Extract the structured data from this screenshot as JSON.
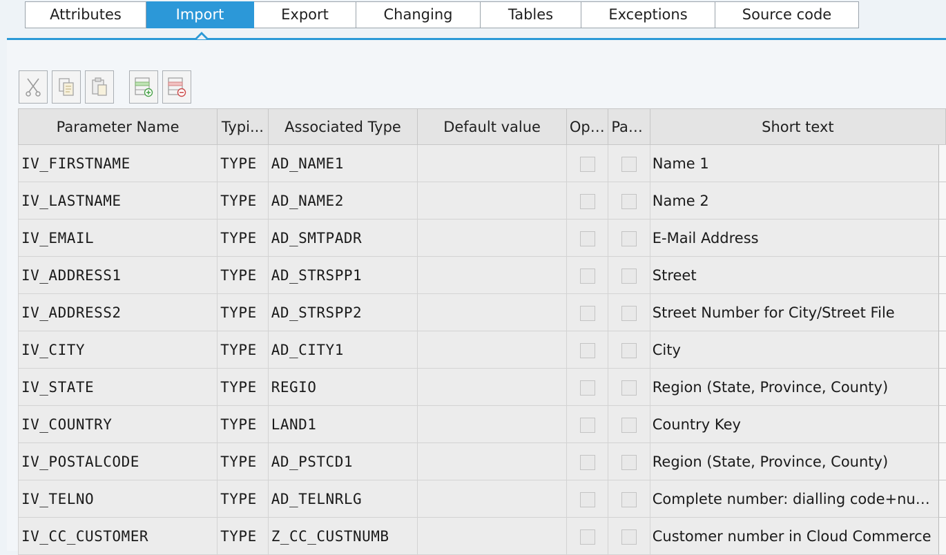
{
  "tabs": [
    {
      "label": "Attributes",
      "active": false
    },
    {
      "label": "Import",
      "active": true
    },
    {
      "label": "Export",
      "active": false
    },
    {
      "label": "Changing",
      "active": false
    },
    {
      "label": "Tables",
      "active": false
    },
    {
      "label": "Exceptions",
      "active": false
    },
    {
      "label": "Source code",
      "active": false
    }
  ],
  "toolbar": {
    "buttons": [
      {
        "icon": "cut-icon"
      },
      {
        "icon": "copy-icon"
      },
      {
        "icon": "paste-icon"
      },
      {
        "icon": "insert-row-icon"
      },
      {
        "icon": "delete-row-icon"
      }
    ]
  },
  "table": {
    "columns": [
      "Parameter Name",
      "Typi...",
      "Associated Type",
      "Default value",
      "Opt...",
      "Pas...",
      "Short text"
    ],
    "rows": [
      {
        "name": "IV_FIRSTNAME",
        "typing": "TYPE",
        "assoc": "AD_NAME1",
        "default": "",
        "optional": false,
        "pass_value": false,
        "short_text": "Name 1"
      },
      {
        "name": "IV_LASTNAME",
        "typing": "TYPE",
        "assoc": "AD_NAME2",
        "default": "",
        "optional": false,
        "pass_value": false,
        "short_text": "Name 2"
      },
      {
        "name": "IV_EMAIL",
        "typing": "TYPE",
        "assoc": "AD_SMTPADR",
        "default": "",
        "optional": false,
        "pass_value": false,
        "short_text": "E-Mail Address"
      },
      {
        "name": "IV_ADDRESS1",
        "typing": "TYPE",
        "assoc": "AD_STRSPP1",
        "default": "",
        "optional": false,
        "pass_value": false,
        "short_text": "Street"
      },
      {
        "name": "IV_ADDRESS2",
        "typing": "TYPE",
        "assoc": "AD_STRSPP2",
        "default": "",
        "optional": false,
        "pass_value": false,
        "short_text": "Street Number for City/Street File"
      },
      {
        "name": "IV_CITY",
        "typing": "TYPE",
        "assoc": "AD_CITY1",
        "default": "",
        "optional": false,
        "pass_value": false,
        "short_text": "City"
      },
      {
        "name": "IV_STATE",
        "typing": "TYPE",
        "assoc": "REGIO",
        "default": "",
        "optional": false,
        "pass_value": false,
        "short_text": "Region (State, Province, County)"
      },
      {
        "name": "IV_COUNTRY",
        "typing": "TYPE",
        "assoc": "LAND1",
        "default": "",
        "optional": false,
        "pass_value": false,
        "short_text": "Country Key"
      },
      {
        "name": "IV_POSTALCODE",
        "typing": "TYPE",
        "assoc": "AD_PSTCD1",
        "default": "",
        "optional": false,
        "pass_value": false,
        "short_text": "Region (State, Province, County)"
      },
      {
        "name": "IV_TELNO",
        "typing": "TYPE",
        "assoc": "AD_TELNRLG",
        "default": "",
        "optional": false,
        "pass_value": false,
        "short_text": "Complete number: dialling code+num..."
      },
      {
        "name": "IV_CC_CUSTOMER",
        "typing": "TYPE",
        "assoc": "Z_CC_CUSTNUMB",
        "default": "",
        "optional": false,
        "pass_value": false,
        "short_text": "Customer number in Cloud Commerce"
      }
    ]
  },
  "colors": {
    "accent": "#2c98d8",
    "cell_bg": "#ececec",
    "header_bg": "#e4e4e4"
  }
}
